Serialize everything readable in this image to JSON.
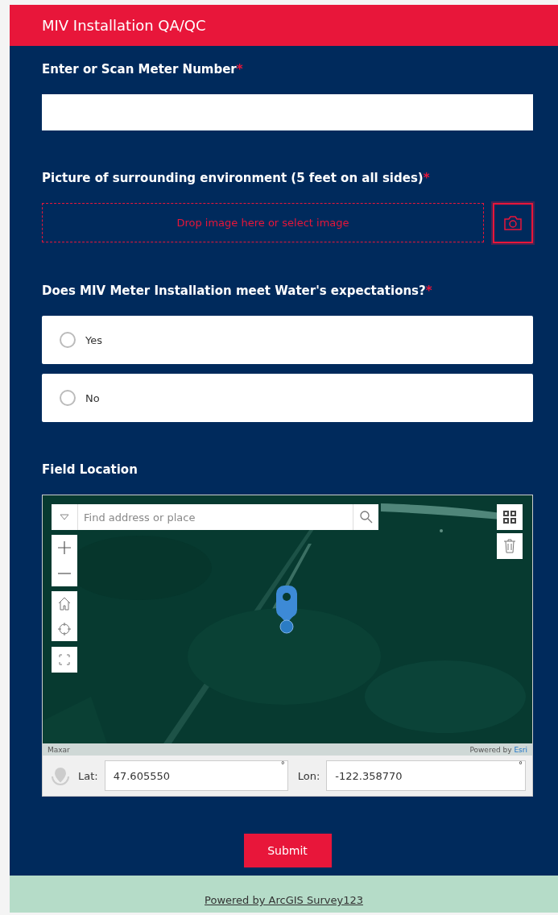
{
  "header": {
    "title": "MIV Installation QA/QC"
  },
  "questions": [
    {
      "kind": "text",
      "label": "Enter or Scan Meter Number",
      "required_mark": "*"
    },
    {
      "label": "Picture of surrounding environment (5 feet on all sides)",
      "required_mark": "*",
      "drop_text": "Drop image here or select image"
    },
    {
      "kind": "choice",
      "label": "Does MIV Meter Installation meet Water's expectations?",
      "required_mark": "*",
      "options": [
        {
          "label": "Yes",
          "selected": false
        },
        {
          "label": "No",
          "selected": false
        }
      ]
    },
    {
      "kind": "map",
      "label": "Field Location",
      "search_placeholder": "Find address or place",
      "attribution": "Maxar",
      "powered_by": "Powered by",
      "powered_link": "Esri",
      "lat_label": "Lat:",
      "lat": "47.605550",
      "lat_unit": "°",
      "lon_label": "Lon:",
      "lon": "-122.358770",
      "lon_unit": "°"
    }
  ],
  "submit": "Submit",
  "footer": "Powered by ArcGIS Survey123"
}
